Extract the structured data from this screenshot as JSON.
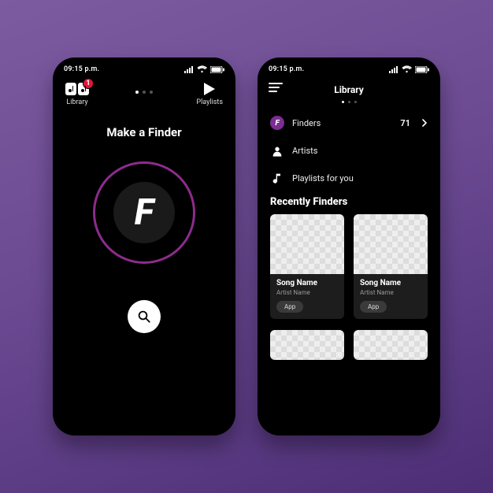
{
  "status": {
    "time": "09:15 p.m."
  },
  "screen1": {
    "library_label": "Library",
    "library_badge": "1",
    "playlists_label": "Playlists",
    "headline": "Make a Finder",
    "logo_letter": "F"
  },
  "screen2": {
    "title": "Library",
    "rows": {
      "finders": {
        "label": "Finders",
        "count": "71",
        "icon_letter": "F"
      },
      "artists": {
        "label": "Artists"
      },
      "playlists": {
        "label": "Playlists for you"
      }
    },
    "section": "Recently Finders",
    "cards": [
      {
        "song": "Song Name",
        "artist": "Artist Name",
        "tag": "App"
      },
      {
        "song": "Song Name",
        "artist": "Artist Name",
        "tag": "App"
      }
    ]
  }
}
